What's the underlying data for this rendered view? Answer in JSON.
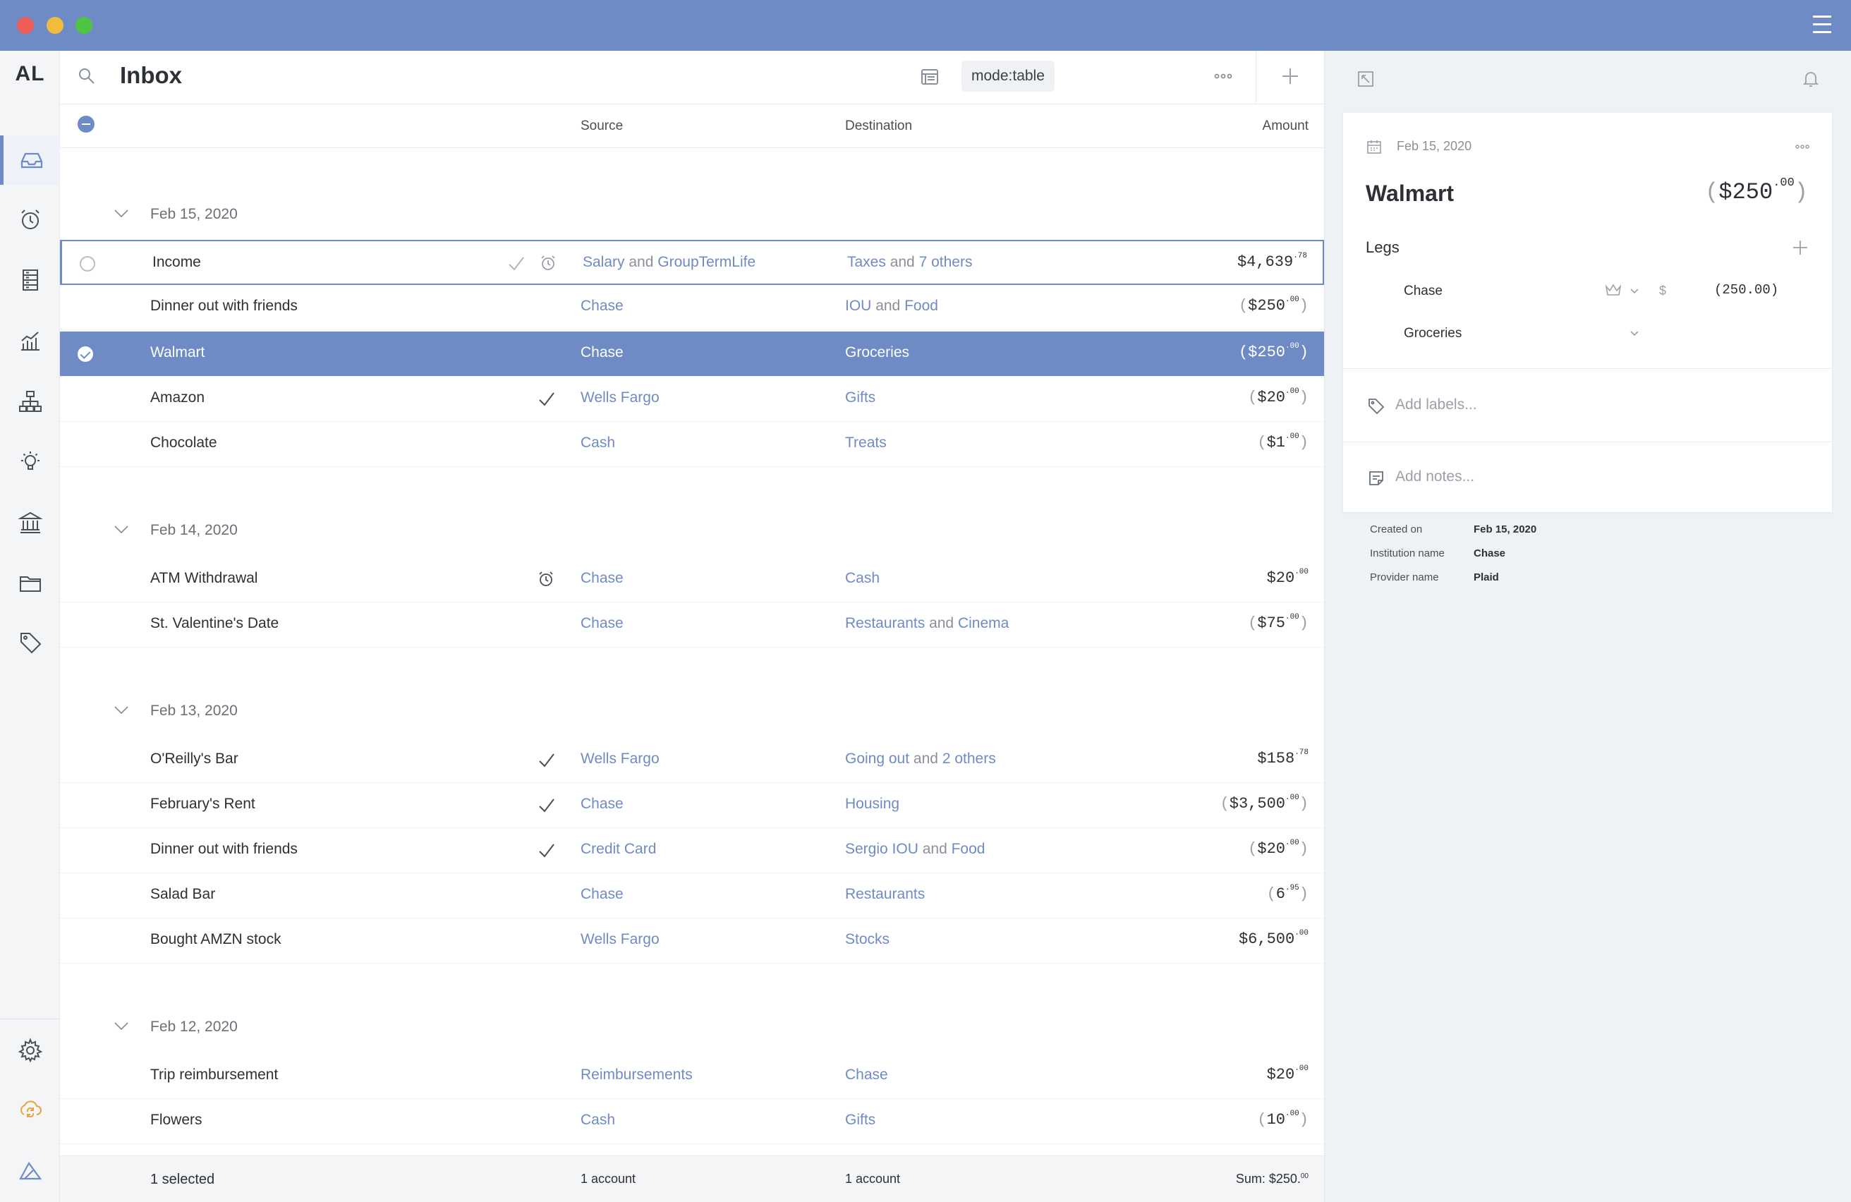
{
  "app": {
    "logo": "AL"
  },
  "header": {
    "title": "Inbox",
    "mode": "mode:table"
  },
  "columns": {
    "source": "Source",
    "destination": "Destination",
    "amount": "Amount"
  },
  "groups": [
    {
      "date": "Feb 15, 2020",
      "rows": [
        {
          "name": "Income",
          "src_a": "Salary",
          "src_join": "and",
          "src_b": "GroupTermLife",
          "dst_a": "Taxes",
          "dst_join": "and",
          "dst_b": "7 others",
          "amount": "$4,639",
          "cents": ".78",
          "negative": false
        },
        {
          "name": "Dinner out with friends",
          "src_a": "Chase",
          "dst_a": "IOU",
          "dst_join": "and",
          "dst_b": "Food",
          "amount": "$250",
          "cents": ".00",
          "negative": true
        },
        {
          "name": "Walmart",
          "src_a": "Chase",
          "dst_a": "Groceries",
          "amount": "$250",
          "cents": ".00",
          "negative": true
        },
        {
          "name": "Amazon",
          "src_a": "Wells Fargo",
          "dst_a": "Gifts",
          "amount": "$20",
          "cents": ".00",
          "negative": true
        },
        {
          "name": "Chocolate",
          "src_a": "Cash",
          "dst_a": "Treats",
          "amount": "$1",
          "cents": ".00",
          "negative": true
        }
      ]
    },
    {
      "date": "Feb 14, 2020",
      "rows": [
        {
          "name": "ATM Withdrawal",
          "src_a": "Chase",
          "dst_a": "Cash",
          "amount": "$20",
          "cents": ".00",
          "negative": false
        },
        {
          "name": "St. Valentine's Date",
          "src_a": "Chase",
          "dst_a": "Restaurants",
          "dst_join": "and",
          "dst_b": "Cinema",
          "amount": "$75",
          "cents": ".00",
          "negative": true
        }
      ]
    },
    {
      "date": "Feb 13, 2020",
      "rows": [
        {
          "name": "O'Reilly's Bar",
          "src_a": "Wells Fargo",
          "dst_a": "Going out",
          "dst_join": "and",
          "dst_b": "2 others",
          "amount": "$158",
          "cents": ".78",
          "negative": false
        },
        {
          "name": "February's Rent",
          "src_a": "Chase",
          "dst_a": "Housing",
          "amount": "$3,500",
          "cents": ".00",
          "negative": true
        },
        {
          "name": "Dinner out with friends",
          "src_a": "Credit Card",
          "dst_a": "Sergio IOU",
          "dst_join": "and",
          "dst_b": "Food",
          "amount": "$20",
          "cents": ".00",
          "negative": true
        },
        {
          "name": "Salad Bar",
          "src_a": "Chase",
          "dst_a": "Restaurants",
          "amount": "6",
          "cents": ".95",
          "negative": true
        },
        {
          "name": "Bought AMZN stock",
          "src_a": "Wells Fargo",
          "dst_a": "Stocks",
          "amount": "$6,500",
          "cents": ".00",
          "negative": false
        }
      ]
    },
    {
      "date": "Feb 12, 2020",
      "rows": [
        {
          "name": "Trip reimbursement",
          "src_a": "Reimbursements",
          "dst_a": "Chase",
          "amount": "$20",
          "cents": ".00",
          "negative": false
        },
        {
          "name": "Flowers",
          "src_a": "Cash",
          "dst_a": "Gifts",
          "amount": "10",
          "cents": ".00",
          "negative": true
        }
      ]
    }
  ],
  "footer": {
    "selected": "1 selected",
    "source": "1 account",
    "destination": "1 account",
    "sum": "Sum: $250.",
    "sum_cents": "00"
  },
  "detail": {
    "date": "Feb 15, 2020",
    "title": "Walmart",
    "amount": "$250",
    "amount_cents": ".00",
    "legs_label": "Legs",
    "leg1_account": "Chase",
    "leg1_currency": "$",
    "leg1_amount": "(250.00)",
    "leg2_account": "Groceries",
    "labels_placeholder": "Add labels...",
    "notes_placeholder": "Add notes...",
    "meta": [
      {
        "label": "Created on",
        "value": "Feb 15, 2020"
      },
      {
        "label": "Institution name",
        "value": "Chase"
      },
      {
        "label": "Provider name",
        "value": "Plaid"
      }
    ]
  },
  "colors": {
    "accent": "#6e8bc6",
    "titlebar": "#6e8bc6",
    "link": "#6e8bc6",
    "selected_row": "#6e8bc6"
  }
}
